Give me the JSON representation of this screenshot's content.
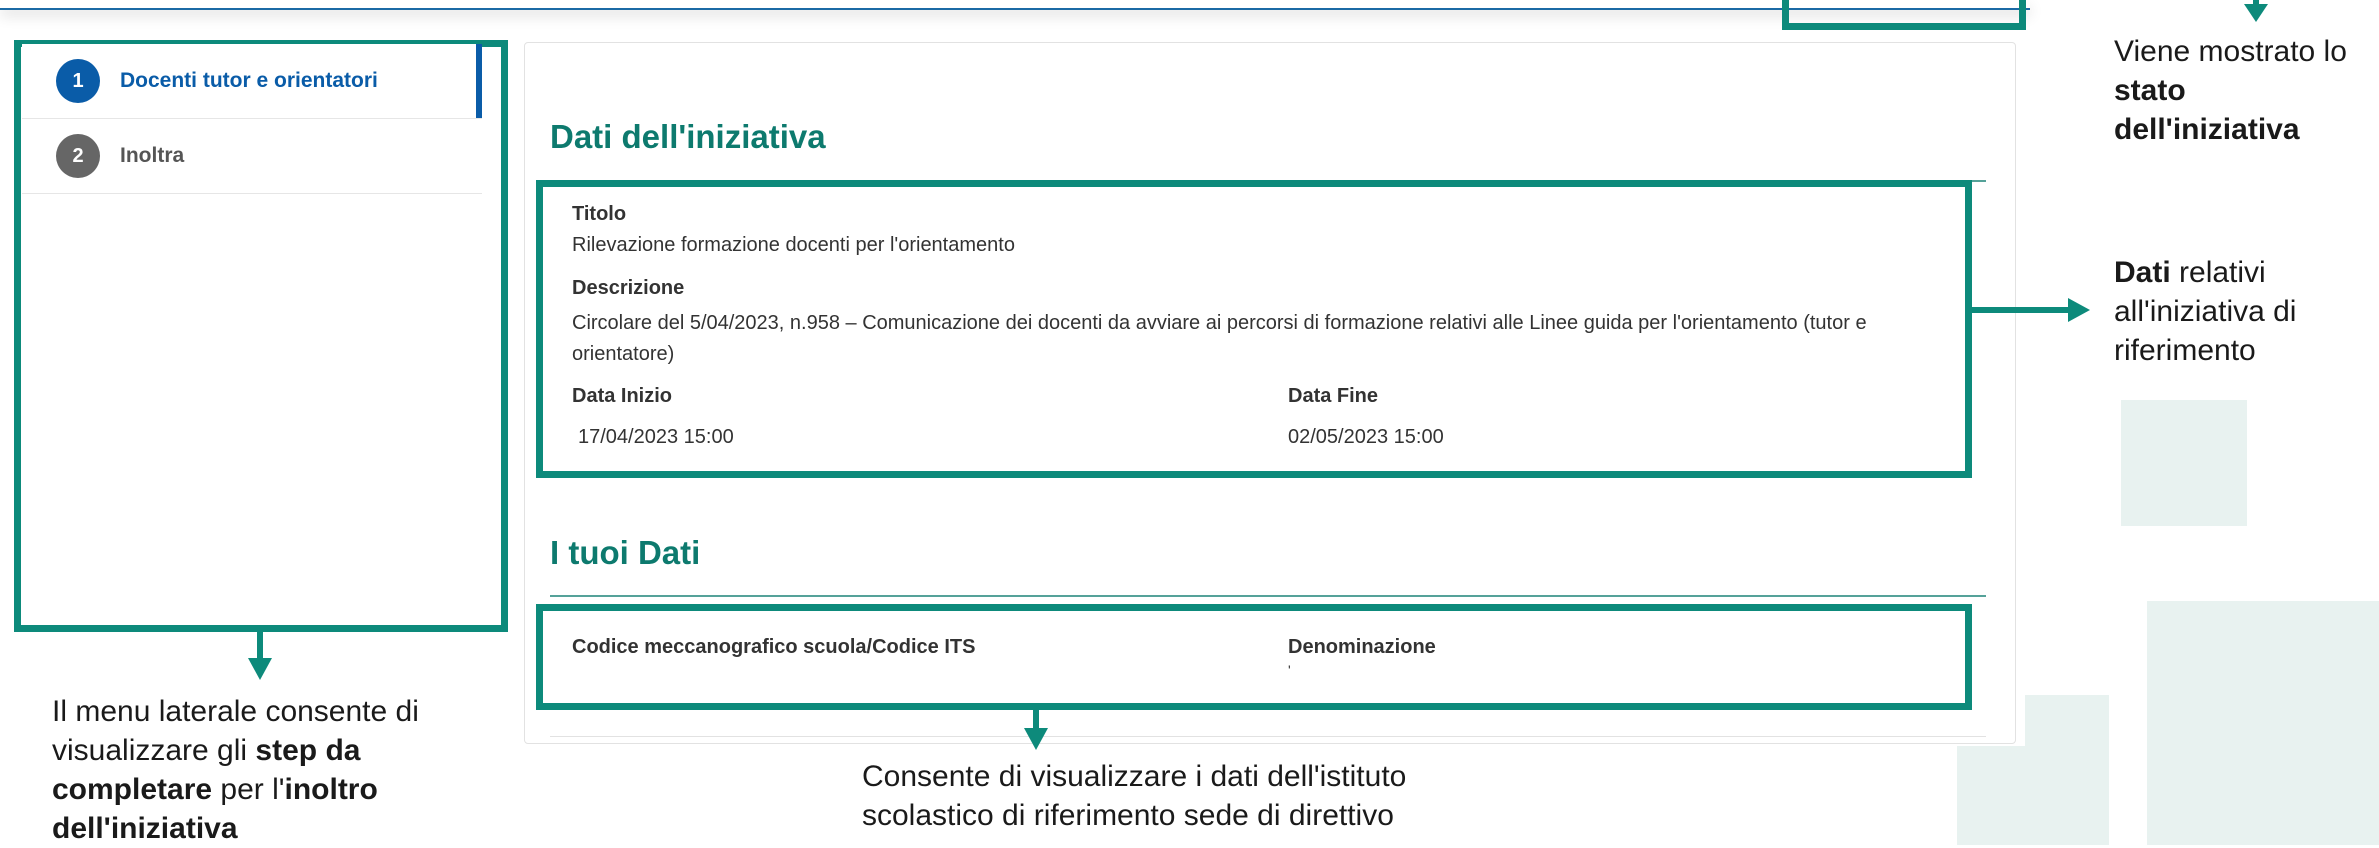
{
  "sidebar": {
    "steps": [
      {
        "number": "1",
        "label": "Docenti tutor e orientatori"
      },
      {
        "number": "2",
        "label": "Inoltra"
      }
    ]
  },
  "iniziativa": {
    "section_title": "Dati dell'iniziativa",
    "titolo_label": "Titolo",
    "titolo_value": "Rilevazione formazione docenti per l'orientamento",
    "descrizione_label": "Descrizione",
    "descrizione_value": "Circolare del 5/04/2023, n.958 – Comunicazione dei docenti da avviare ai percorsi di formazione relativi alle Linee guida per l'orientamento (tutor e orientatore)",
    "data_inizio_label": "Data Inizio",
    "data_inizio_value": "17/04/2023 15:00",
    "data_fine_label": "Data Fine",
    "data_fine_value": "02/05/2023 15:00"
  },
  "tuoi_dati": {
    "section_title": "I tuoi Dati",
    "codice_label": "Codice meccanografico scuola/Codice ITS",
    "denominazione_label": "Denominazione",
    "denominazione_value": "'"
  },
  "annotations": {
    "stato": {
      "line1": "Viene mostrato lo",
      "bold1": "stato",
      "bold2": "dell'iniziativa"
    },
    "dati": {
      "bold": "Dati",
      "line1": " relativi",
      "line2": "all'iniziativa di",
      "line3": "riferimento"
    },
    "menu": {
      "line1": "Il menu laterale consente di",
      "line2": "visualizzare gli ",
      "bold2": "step da",
      "bold3": "completare",
      "line3": " per l'",
      "bold3b": "inoltro",
      "bold4": "dell'iniziativa"
    },
    "istituto": {
      "line1": "Consente di visualizzare i dati dell'istituto",
      "line2": "scolastico di riferimento sede di direttivo"
    }
  },
  "colors": {
    "accent_green": "#0d8a7b",
    "active_blue": "#0a5ca8"
  }
}
